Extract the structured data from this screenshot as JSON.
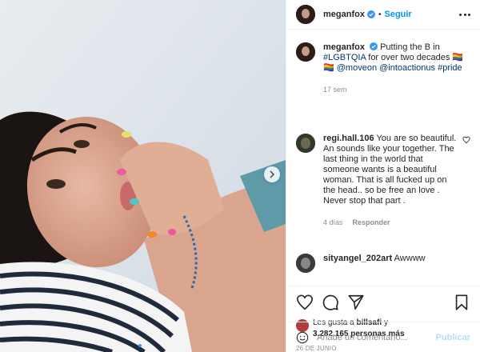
{
  "post": {
    "username": "meganfox",
    "follow_label": "Seguir",
    "separator": "•"
  },
  "caption": {
    "username": "meganfox",
    "text_before": "Putting the B in ",
    "hashtag_lgbtqia": "#LGBTQIA",
    "text_mid": " for over two decades 🏳️‍🌈🏳️‍🌈 ",
    "mention_moveon": "@moveon",
    "mention_intoaction": "@intoactionus",
    "hashtag_pride": "#pride",
    "time": "17 sem"
  },
  "comments": [
    {
      "username": "regi.hall.106",
      "text": "You are so beautiful. An sounds like your together. The last thing in the world that someone wants is a beautiful woman. That is all fucked up on the head.. so be free an love . Never stop that part .",
      "time": "4 días",
      "reply_label": "Responder"
    },
    {
      "username": "sityangel_202art",
      "text": "Awwww"
    }
  ],
  "likes": {
    "prefix": "Les gusta a ",
    "user": "billsafi",
    "conj": " y",
    "count": "3.282.165 personas más"
  },
  "date": "26 DE JUNIO",
  "add_comment": {
    "placeholder": "Añade un comentario...",
    "publish_label": "Publicar"
  },
  "colors": {
    "accent": "#0095f6",
    "muted": "#8e8e8e",
    "link": "#00376b",
    "publish_disabled": "#b2dffc"
  },
  "icons": [
    "verified-icon",
    "more-icon",
    "carousel-next-icon",
    "heart-icon",
    "comment-icon",
    "share-icon",
    "bookmark-icon",
    "emoji-icon"
  ]
}
